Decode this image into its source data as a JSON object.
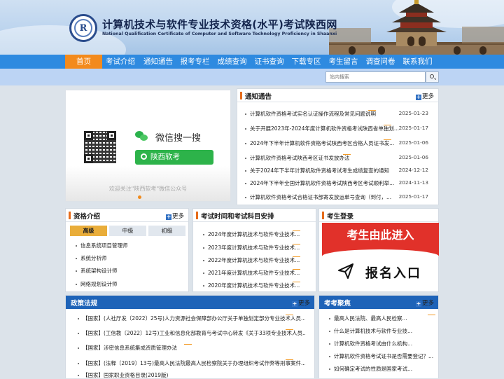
{
  "header": {
    "title": "计算机技术与软件专业技术资格(水平)考试陕西网",
    "subtitle": "National Qualification Certificate of Computer and Software Technology Proficiency in Shaanxi",
    "logo_letter": "R"
  },
  "nav": [
    "首页",
    "考试介绍",
    "通知通告",
    "报考专栏",
    "成绩查询",
    "证书查询",
    "下载专区",
    "考生留言",
    "调查问卷",
    "联系我们"
  ],
  "search": {
    "placeholder": "站内搜索"
  },
  "banner": {
    "wx_search": "微信搜一搜",
    "wx_button": "陕西软考",
    "caption": "欢迎关注\"陕西软考\"微信公众号"
  },
  "more": "更多",
  "notices": {
    "title": "通知通告",
    "items": [
      {
        "text": "计算机软件资格考试实名认证操作流程及常见问题说明",
        "date": "2025-01-23"
      },
      {
        "text": "关于开展2023年-2024年度计算机软件资格考试陕西省单独划...",
        "date": "2025-01-17"
      },
      {
        "text": "2024年下半年计算机软件资格考试陕西考区合格人员证书发...",
        "date": "2025-01-06"
      },
      {
        "text": "计算机软件资格考试陕西考区证书发放办法",
        "date": "2025-01-06"
      },
      {
        "text": "关于2024年下半年计算机软件资格考试考生成绩复查的通知",
        "date": "2024-12-12"
      },
      {
        "text": "2024年下半年全国计算机软件资格考试陕西考区考试顺利举...",
        "date": "2024-11-13"
      },
      {
        "text": "计算机软件资格考试合格证书部寄发放运单号查询（到付，...",
        "date": "2025-01-17"
      }
    ]
  },
  "qualification": {
    "title": "资格介绍",
    "tabs": [
      "高级",
      "中级",
      "初级"
    ],
    "items": [
      "信息系统项目管理师",
      "系统分析师",
      "系统架构设计师",
      "网络规划设计师"
    ]
  },
  "schedule": {
    "title": "考试时间和考试科目安排",
    "items": [
      "2024年度计算机技术与软件专业技术...",
      "2023年度计算机技术与软件专业技术...",
      "2022年度计算机技术与软件专业技术...",
      "2021年度计算机技术与软件专业技术...",
      "2020年度计算机技术与软件专业技术..."
    ]
  },
  "login": {
    "title": "考生登录",
    "entry": "考生由此进入",
    "register": "报名入口"
  },
  "policy": {
    "title": "政策法规",
    "items": [
      "【国家】(人社厅发〔2022〕25号)人力资源社会保障部办公厅关于单独划定部分专业技术人员...",
      "【国家】(工信教〔2022〕12号)工业和信息化部教育与考试中心转发《关于33项专业技术人员...",
      "【国家】涉密信息系统集成资质管理办法",
      "【国家】(法释〔2019〕13号)最高人民法院最高人民检察院关于办理组织考试作弊等刑事案件...",
      "【国家】国家职业资格目录(2019版)"
    ]
  },
  "focus": {
    "title": "考考聚焦",
    "items": [
      "最高人民法院、最高人民检察...",
      "什么是计算机技术与软件专业技...",
      "计算机软件资格考试由什么机构...",
      "计算机软件资格考试证书是否需要登记？...",
      "如何确定考试的性质是国家考试..."
    ]
  }
}
